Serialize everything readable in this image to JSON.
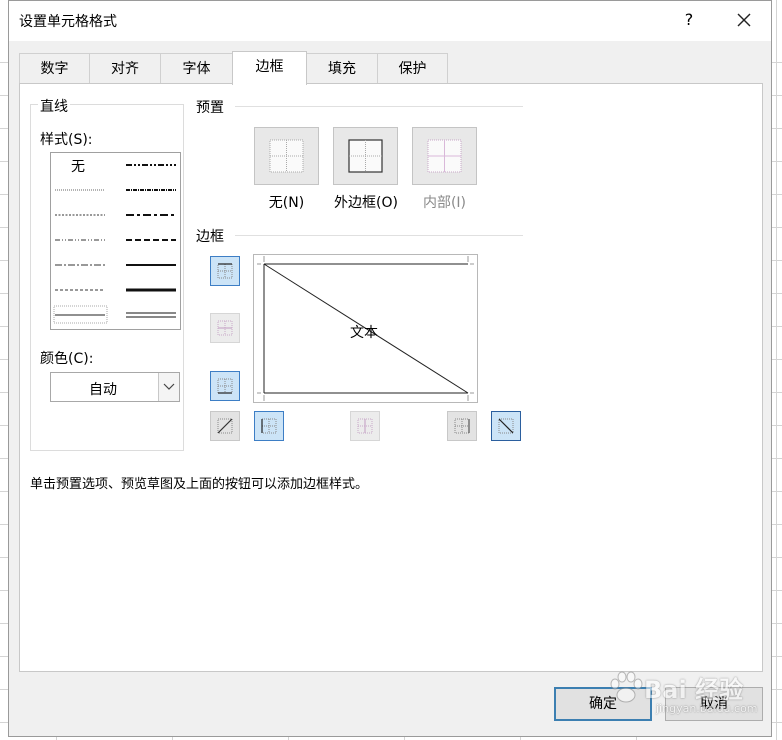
{
  "dialog": {
    "title": "设置单元格格式",
    "help": "?",
    "close": "✕"
  },
  "tabs": [
    {
      "label": "数字"
    },
    {
      "label": "对齐"
    },
    {
      "label": "字体"
    },
    {
      "label": "边框",
      "active": true
    },
    {
      "label": "填充"
    },
    {
      "label": "保护"
    }
  ],
  "line_group": {
    "title": "直线",
    "style_label": "样式(S):",
    "style_none": "无",
    "color_label": "颜色(C):",
    "color_value": "自动"
  },
  "presets": {
    "title": "预置",
    "none": "无(N)",
    "outline": "外边框(O)",
    "inside": "内部(I)"
  },
  "border": {
    "title": "边框",
    "preview_text": "文本"
  },
  "hint": "单击预置选项、预览草图及上面的按钮可以添加边框样式。",
  "buttons": {
    "ok": "确定",
    "cancel": "取消"
  },
  "watermark": {
    "main": "Bai 经验",
    "sub": "jingyan.baidu.com"
  }
}
